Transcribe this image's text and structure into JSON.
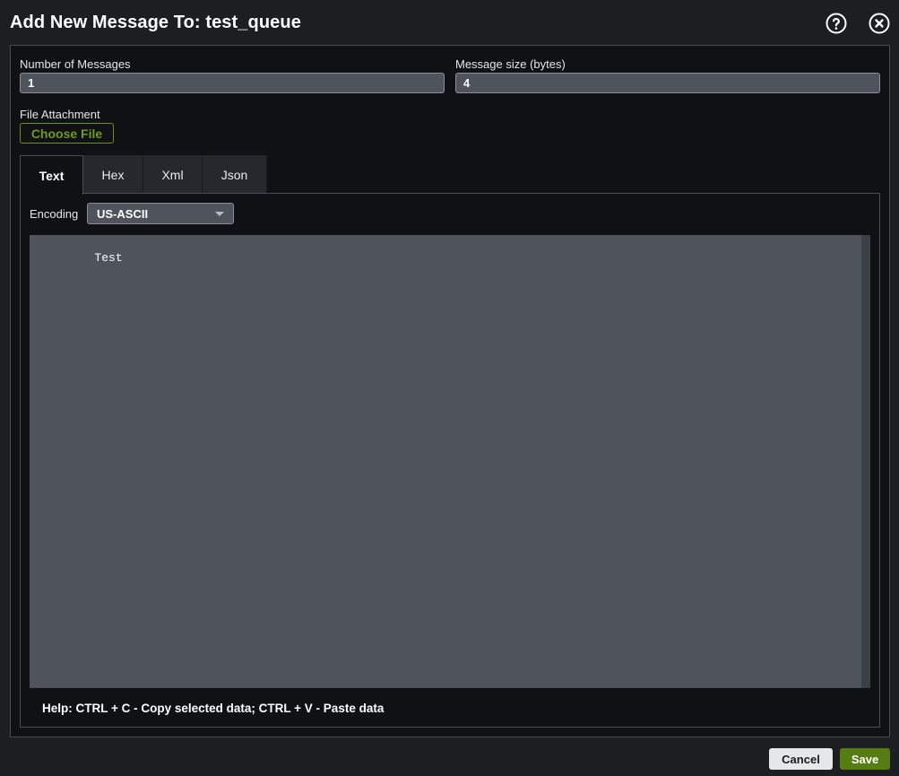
{
  "dialog": {
    "title": "Add New Message To: test_queue",
    "help_icon": "question-circle-icon",
    "close_icon": "close-circle-icon"
  },
  "form": {
    "num_messages_label": "Number of Messages",
    "num_messages_value": "1",
    "msg_size_label": "Message size (bytes)",
    "msg_size_value": "4",
    "file_attachment_label": "File Attachment",
    "choose_file_label": "Choose File"
  },
  "tabs": [
    {
      "label": "Text",
      "active": true
    },
    {
      "label": "Hex",
      "active": false
    },
    {
      "label": "Xml",
      "active": false
    },
    {
      "label": "Json",
      "active": false
    }
  ],
  "panel": {
    "encoding_label": "Encoding",
    "encoding_value": "US-ASCII",
    "editor_content": "Test",
    "help_text": "Help: CTRL + C - Copy selected data; CTRL + V - Paste data"
  },
  "footer": {
    "cancel_label": "Cancel",
    "save_label": "Save"
  },
  "colors": {
    "accent_green": "#567d12",
    "choose_file_green": "#6f9a1f",
    "background": "#1d1e22"
  }
}
